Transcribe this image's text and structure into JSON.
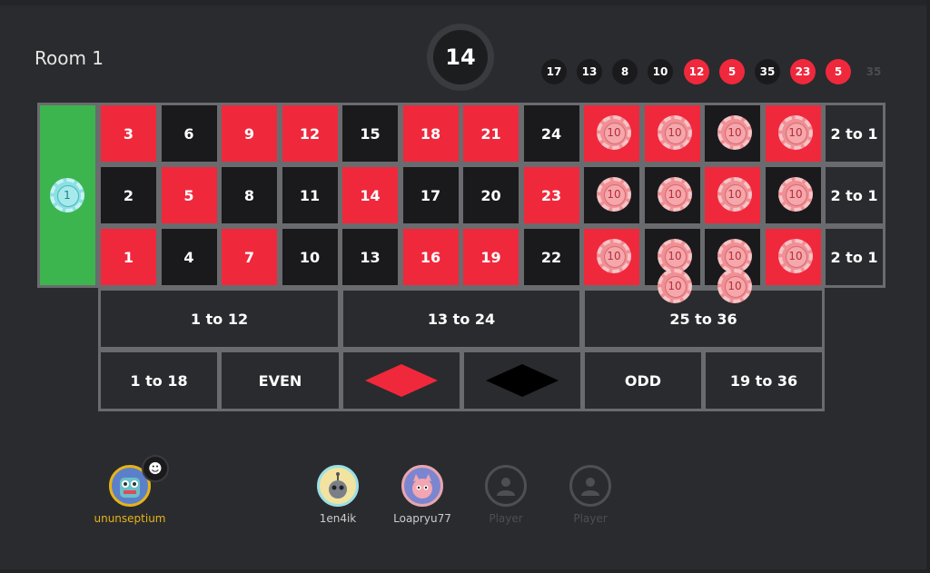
{
  "room": {
    "title": "Room 1"
  },
  "current_number": "14",
  "history": [
    {
      "value": "17",
      "color": "black"
    },
    {
      "value": "13",
      "color": "black"
    },
    {
      "value": "8",
      "color": "black"
    },
    {
      "value": "10",
      "color": "black"
    },
    {
      "value": "12",
      "color": "red"
    },
    {
      "value": "5",
      "color": "red"
    },
    {
      "value": "35",
      "color": "black"
    },
    {
      "value": "23",
      "color": "red"
    },
    {
      "value": "5",
      "color": "red"
    },
    {
      "value": "35",
      "color": "faded"
    }
  ],
  "board": {
    "rows": [
      [
        {
          "n": "3",
          "c": "red"
        },
        {
          "n": "6",
          "c": "black"
        },
        {
          "n": "9",
          "c": "red"
        },
        {
          "n": "12",
          "c": "red"
        },
        {
          "n": "15",
          "c": "black"
        },
        {
          "n": "18",
          "c": "red"
        },
        {
          "n": "21",
          "c": "red"
        },
        {
          "n": "24",
          "c": "black"
        },
        {
          "n": "",
          "c": "red"
        },
        {
          "n": "",
          "c": "red"
        },
        {
          "n": "",
          "c": "black"
        },
        {
          "n": "",
          "c": "red"
        }
      ],
      [
        {
          "n": "2",
          "c": "black"
        },
        {
          "n": "5",
          "c": "red"
        },
        {
          "n": "8",
          "c": "black"
        },
        {
          "n": "11",
          "c": "black"
        },
        {
          "n": "14",
          "c": "red"
        },
        {
          "n": "17",
          "c": "black"
        },
        {
          "n": "20",
          "c": "black"
        },
        {
          "n": "23",
          "c": "red"
        },
        {
          "n": "",
          "c": "black"
        },
        {
          "n": "",
          "c": "black"
        },
        {
          "n": "",
          "c": "red"
        },
        {
          "n": "",
          "c": "black"
        }
      ],
      [
        {
          "n": "1",
          "c": "red"
        },
        {
          "n": "4",
          "c": "black"
        },
        {
          "n": "7",
          "c": "red"
        },
        {
          "n": "10",
          "c": "black"
        },
        {
          "n": "13",
          "c": "black"
        },
        {
          "n": "16",
          "c": "red"
        },
        {
          "n": "19",
          "c": "red"
        },
        {
          "n": "22",
          "c": "black"
        },
        {
          "n": "",
          "c": "red"
        },
        {
          "n": "",
          "c": "black"
        },
        {
          "n": "",
          "c": "black"
        },
        {
          "n": "",
          "c": "red"
        }
      ]
    ],
    "column_bets": [
      "2 to 1",
      "2 to 1",
      "2 to 1"
    ],
    "dozens": [
      "1 to 12",
      "13 to 24",
      "25 to 36"
    ],
    "outside": {
      "low": "1 to 18",
      "even": "EVEN",
      "odd": "ODD",
      "high": "19 to 36"
    },
    "colors": {
      "red": "#f0283c",
      "black": "#1a1a1c",
      "green": "#3cb54f"
    }
  },
  "chips": {
    "zero_chip": "1",
    "pink_chip_label": "10"
  },
  "players": [
    {
      "name": "ununseptium",
      "self": true
    },
    {
      "name": "1en4ik"
    },
    {
      "name": "Loapryu77"
    },
    {
      "name": "Player",
      "empty": true
    },
    {
      "name": "Player",
      "empty": true
    }
  ]
}
